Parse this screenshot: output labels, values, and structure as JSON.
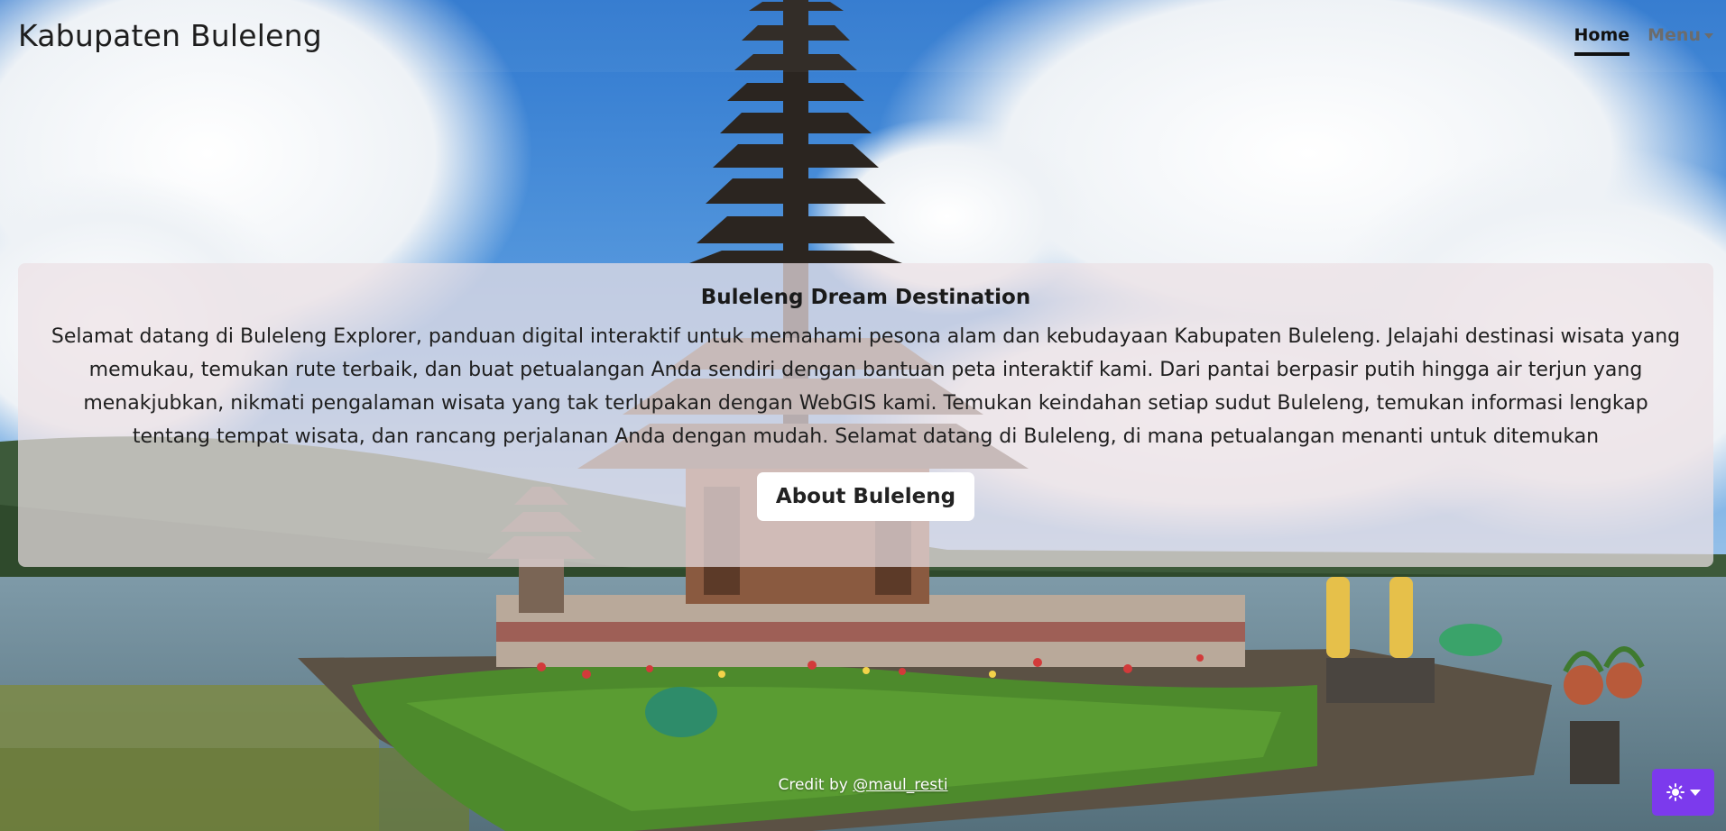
{
  "navbar": {
    "brand": "Kabupaten Buleleng",
    "links": [
      {
        "label": "Home",
        "active": true
      },
      {
        "label": "Menu",
        "active": false,
        "dropdown": true
      }
    ]
  },
  "hero": {
    "title": "Buleleng Dream Destination",
    "text": "Selamat datang di Buleleng Explorer, panduan digital interaktif untuk memahami pesona alam dan kebudayaan Kabupaten Buleleng. Jelajahi destinasi wisata yang memukau, temukan rute terbaik, dan buat petualangan Anda sendiri dengan bantuan peta interaktif kami. Dari pantai berpasir putih hingga air terjun yang menakjubkan, nikmati pengalaman wisata yang tak terlupakan dengan WebGIS kami. Temukan keindahan setiap sudut Buleleng, temukan informasi lengkap tentang tempat wisata, dan rancang perjalanan Anda dengan mudah. Selamat datang di Buleleng, di mana petualangan menanti untuk ditemukan",
    "button_label": "About Buleleng"
  },
  "footer": {
    "credit_prefix": "Credit by ",
    "credit_handle": "@maul_resti"
  },
  "theme_toggle": {
    "icon": "sun-icon"
  },
  "colors": {
    "theme_toggle_bg": "#7c3aed",
    "sky": "#3f86d6",
    "water": "#6f8fa0",
    "grass": "#4d8a2c"
  }
}
